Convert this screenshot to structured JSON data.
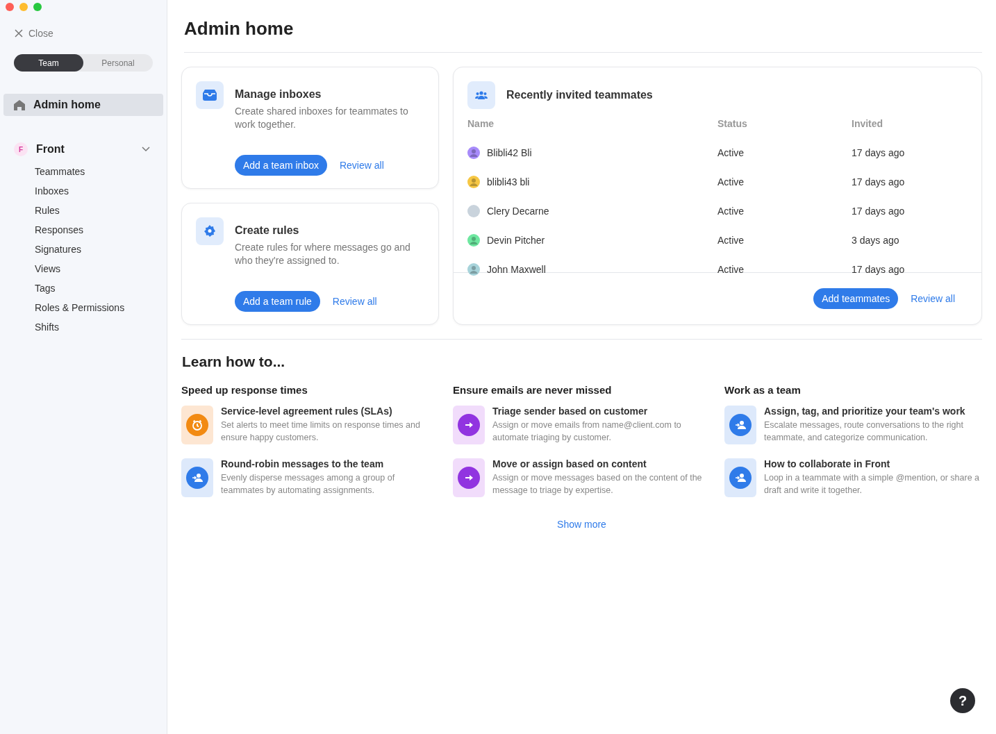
{
  "sidebar": {
    "close_label": "Close",
    "mode_tabs": [
      {
        "label": "Team",
        "selected": true
      },
      {
        "label": "Personal",
        "selected": false
      }
    ],
    "items": [
      {
        "label": "Admin home",
        "selected": true
      }
    ],
    "group": {
      "badge": "F",
      "title": "Front",
      "expanded": true,
      "children": [
        {
          "label": "Teammates"
        },
        {
          "label": "Inboxes"
        },
        {
          "label": "Rules"
        },
        {
          "label": "Responses"
        },
        {
          "label": "Signatures"
        },
        {
          "label": "Views"
        },
        {
          "label": "Tags"
        },
        {
          "label": "Roles & Permissions"
        },
        {
          "label": "Shifts"
        }
      ]
    }
  },
  "page_title": "Admin home",
  "cards": [
    {
      "kind": "inbox",
      "title": "Manage inboxes",
      "description": "Create shared inboxes for teammates to work together.",
      "primary": "Add a team inbox",
      "link": "Review all"
    },
    {
      "kind": "rules",
      "title": "Create rules",
      "description": "Create rules for where messages go and who they're assigned to.",
      "primary": "Add a team rule",
      "link": "Review all"
    }
  ],
  "invited": {
    "title": "Recently invited teammates",
    "columns": [
      "Name",
      "Status",
      "Invited"
    ],
    "rows": [
      {
        "name": "Blibli42 Bli",
        "status": "Active",
        "invited": "17 days ago",
        "kind": "avatar",
        "color": "#a78bfa"
      },
      {
        "name": "blibli43 bli",
        "status": "Active",
        "invited": "17 days ago",
        "kind": "avatar",
        "color": "#f6c744"
      },
      {
        "name": "Clery Decarne",
        "status": "Active",
        "invited": "17 days ago",
        "kind": "photo",
        "color": "#c9d3dc"
      },
      {
        "name": "Devin Pitcher",
        "status": "Active",
        "invited": "3 days ago",
        "kind": "avatar",
        "color": "#6ee7a0"
      },
      {
        "name": "John Maxwell",
        "status": "Active",
        "invited": "17 days ago",
        "kind": "avatar",
        "color": "#a7d3da"
      }
    ],
    "primary": "Add teammates",
    "link": "Review all"
  },
  "learn": {
    "title": "Learn how to...",
    "columns": [
      {
        "heading": "Speed up response times",
        "items": [
          {
            "kind": "clock",
            "title": "Service-level agreement rules (SLAs)",
            "text": "Set alerts to meet time limits on response times and ensure happy customers."
          },
          {
            "kind": "assign",
            "title": "Round-robin messages to the team",
            "text": "Evenly disperse messages among a group of teammates by automating assignments."
          }
        ]
      },
      {
        "heading": "Ensure emails are never missed",
        "items": [
          {
            "kind": "arrow",
            "title": "Triage sender based on customer",
            "text": "Assign or move emails from name@client.com to automate triaging by customer."
          },
          {
            "kind": "arrow",
            "title": "Move or assign based on content",
            "text": "Assign or move messages based on the content of the message to triage by expertise."
          }
        ]
      },
      {
        "heading": "Work as a team",
        "items": [
          {
            "kind": "assign",
            "title": "Assign, tag, and prioritize your team's work",
            "text": "Escalate messages, route conversations to the right teammate, and categorize communication."
          },
          {
            "kind": "assign",
            "title": "How to collaborate in Front",
            "text": "Loop in a teammate with a simple @mention, or share a draft and write it together."
          }
        ]
      }
    ],
    "more": "Show more"
  },
  "help_button": "?"
}
